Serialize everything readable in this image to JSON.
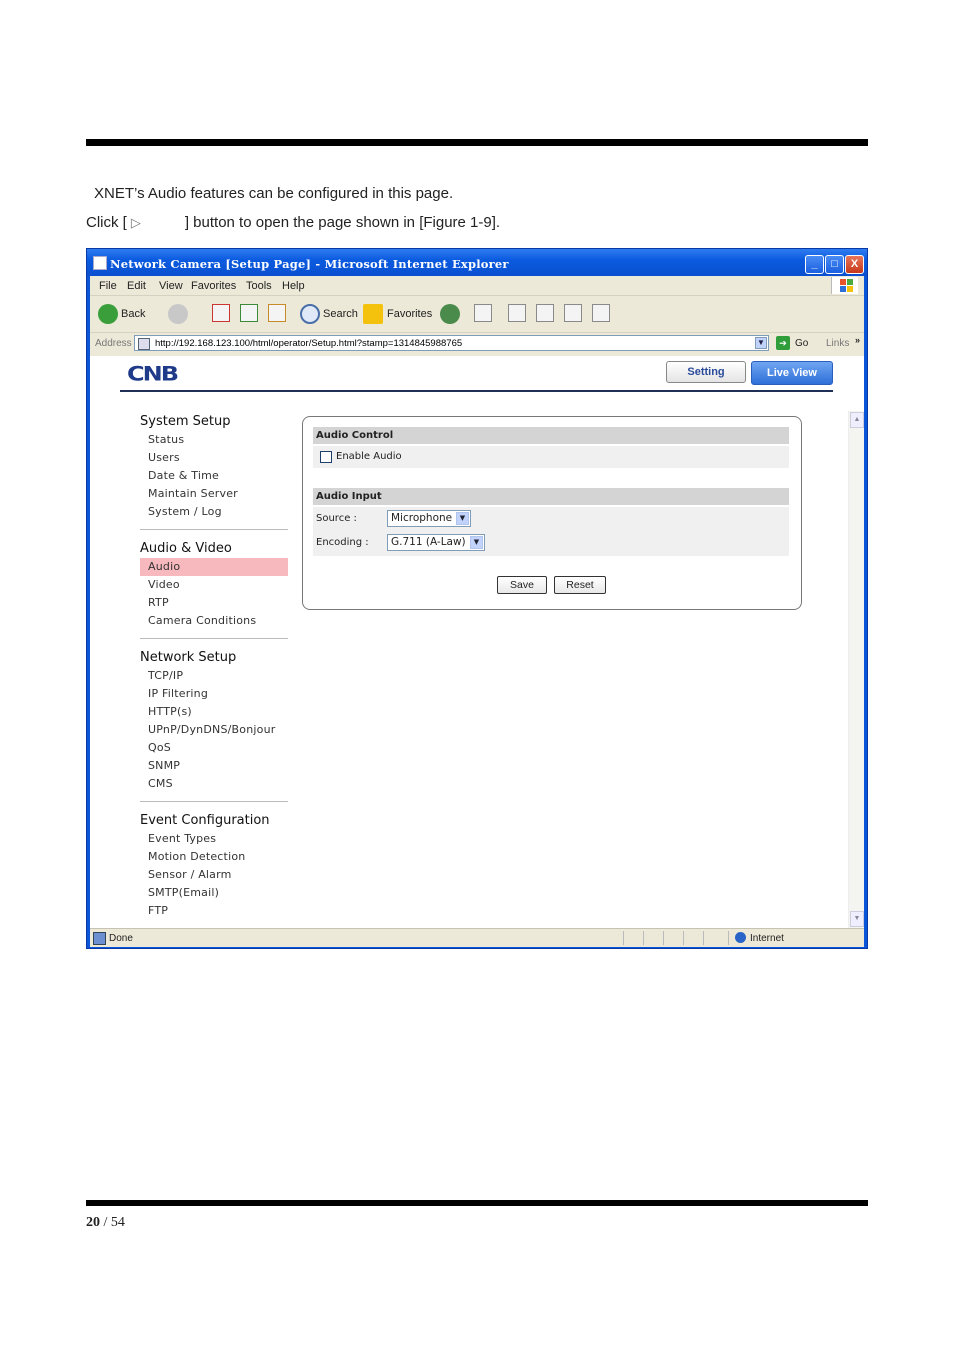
{
  "intro": {
    "line1": "XNET’s Audio features can be configured in this page.",
    "line2_prefix": "Click [",
    "play_glyph": "▷",
    "line2_suffix": "] button to open the page shown in [Figure 1-9]."
  },
  "footer": {
    "page_current": "20",
    "page_sep": "/",
    "page_total": "54"
  },
  "browser": {
    "title": "Network Camera [Setup Page] - Microsoft Internet Explorer",
    "window_buttons": {
      "minimize": "_",
      "maximize": "□",
      "close": "X"
    },
    "menu": [
      "File",
      "Edit",
      "View",
      "Favorites",
      "Tools",
      "Help"
    ],
    "toolbar": {
      "back": "Back",
      "search": "Search",
      "favorites": "Favorites"
    },
    "address_label": "Address",
    "address_url": "http://192.168.123.100/html/operator/Setup.html?stamp=1314845988765",
    "go": "Go",
    "links": "Links",
    "links_chevron": "»",
    "status_text": "Done",
    "zone": "Internet"
  },
  "camera_page": {
    "logo": "CNB",
    "tabs": {
      "setting": "Setting",
      "live_view": "Live View"
    },
    "sidebar": [
      {
        "title": "System Setup",
        "items": [
          "Status",
          "Users",
          "Date & Time",
          "Maintain Server",
          "System / Log"
        ]
      },
      {
        "title": "Audio & Video",
        "items": [
          "Audio",
          "Video",
          "RTP",
          "Camera Conditions"
        ],
        "active": "Audio"
      },
      {
        "title": "Network Setup",
        "items": [
          "TCP/IP",
          "IP Filtering",
          "HTTP(s)",
          "UPnP/DynDNS/Bonjour",
          "QoS",
          "SNMP",
          "CMS"
        ]
      },
      {
        "title": "Event Configuration",
        "items": [
          "Event Types",
          "Motion Detection",
          "Sensor / Alarm",
          "SMTP(Email)",
          "FTP"
        ]
      }
    ],
    "audio_control": {
      "heading": "Audio Control",
      "enable_label": "Enable Audio",
      "enabled": false
    },
    "audio_input": {
      "heading": "Audio Input",
      "source_label": "Source :",
      "source_value": "Microphone",
      "encoding_label": "Encoding :",
      "encoding_value": "G.711 (A-Law)"
    },
    "buttons": {
      "save": "Save",
      "reset": "Reset"
    }
  },
  "colors": {
    "xp_blue": "#0a55d8",
    "active_item": "#f7b9be",
    "section_head": "#d4d4d4",
    "logo": "#1f3a88"
  }
}
